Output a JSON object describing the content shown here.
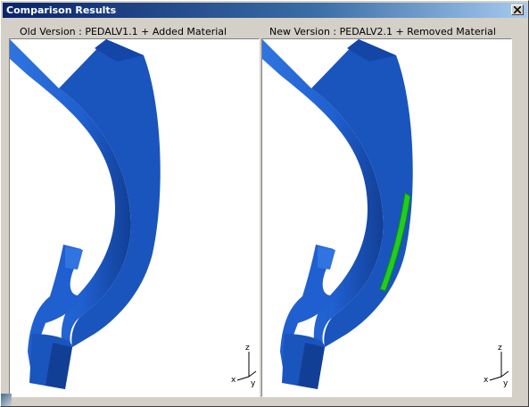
{
  "window": {
    "title": "Comparison Results",
    "close_icon": "close-icon"
  },
  "panes": [
    {
      "label": "Old Version : PEDALV1.1 + Added Material",
      "model_color": "#1f5fcf",
      "highlight": null
    },
    {
      "label": "New Version : PEDALV2.1 + Removed Material",
      "model_color": "#1f5fcf",
      "highlight": "#22cc22"
    }
  ],
  "axes": {
    "z": "z",
    "x": "x",
    "y": "y"
  }
}
